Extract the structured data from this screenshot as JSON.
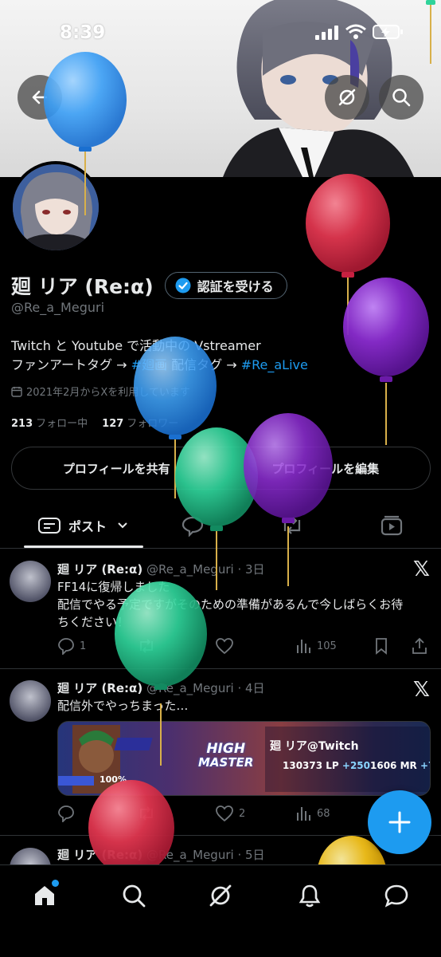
{
  "status_bar": {
    "time": "8:39"
  },
  "profile": {
    "name": "廻 リア (Re:α)",
    "verify_label": "認証を受ける",
    "handle": "@Re_a_Meguri",
    "bio_line1": "Twitch と Youtube で活動中の Vstreamer",
    "bio_line2_prefix": "ファンアートタグ → ",
    "bio_tag1": "#廻画",
    "bio_line2_mid": " 配信タグ → ",
    "bio_tag2": "#Re_aLive",
    "joined": "2021年2月からXを利用しています",
    "following_count": "213",
    "following_label": "フォロー中",
    "followers_count": "127",
    "followers_label": "フォロワー"
  },
  "actions": {
    "share": "プロフィールを共有",
    "edit": "プロフィールを編集"
  },
  "tabs": {
    "posts_label": "ポスト"
  },
  "posts": [
    {
      "name": "廻 リア (Re:α)",
      "meta": "@Re_a_Meguri · 3日",
      "text1": "FF14に復帰しました",
      "text2": "配信でやる予定ですがそのための準備があるんで今しばらくお待",
      "text3": "ちください！",
      "replies": "1",
      "likes": "",
      "views": "105"
    },
    {
      "name": "廻 リア (Re:α)",
      "meta": "@Re_a_Meguri · 4日",
      "text1": "配信外でやっちまった…",
      "replies": "",
      "likes": "2",
      "views": "68"
    },
    {
      "name": "廻 リア (Re:α)",
      "meta": "@Re_a_Meguri · 5日"
    }
  ],
  "media_card": {
    "rank_line1": "HIGH",
    "rank_line2": "MASTER",
    "player": "廻 リア@Twitch",
    "lp": "130373 LP",
    "lp_delta": "+250",
    "mr": "1606 MR",
    "mr_delta": "+7",
    "percent": "100%"
  },
  "colors": {
    "accent": "#1d9bf0",
    "background": "#000000",
    "balloon_blue": "#3ea0f5",
    "balloon_red": "#e0364f",
    "balloon_purple": "#8a2ccf",
    "balloon_green": "#2fd39a",
    "balloon_yellow": "#f4c21b"
  }
}
